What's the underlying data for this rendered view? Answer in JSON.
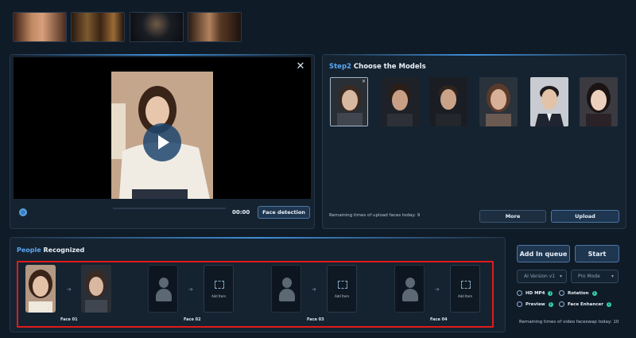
{
  "player": {
    "time": "00:00",
    "face_detection_label": "Face detection",
    "close_symbol": "✕"
  },
  "step2": {
    "step_label": "Step2",
    "title": "Choose the Models",
    "more_label": "More",
    "upload_label": "Upload",
    "remaining_text": "Remaining times of upload faces today: 9",
    "close_symbol": "✕"
  },
  "people": {
    "title_accent": "People",
    "title_rest": "Recognized",
    "add_label": "Add Item",
    "faces": [
      "Face 01",
      "Face 02",
      "Face 03",
      "Face 04"
    ]
  },
  "controls": {
    "add_queue_label": "Add In queue",
    "start_label": "Start",
    "ai_version": "AI Version v1",
    "pro_mode": "Pro Mode",
    "options": [
      {
        "label": "HD MP4",
        "info": "i"
      },
      {
        "label": "Rotation",
        "info": "i"
      },
      {
        "label": "Preview",
        "info": "i"
      },
      {
        "label": "Face Enhancer",
        "info": "i"
      }
    ],
    "remaining_text": "Remaining times of video faceswap today: 10"
  },
  "icons": {
    "play": "play-icon",
    "settings": "gear-icon",
    "chevron": "▾"
  },
  "colors": {
    "accent": "#5aa8f0",
    "highlight_border": "#e01b1b",
    "info_dot": "#2fd2a6"
  }
}
